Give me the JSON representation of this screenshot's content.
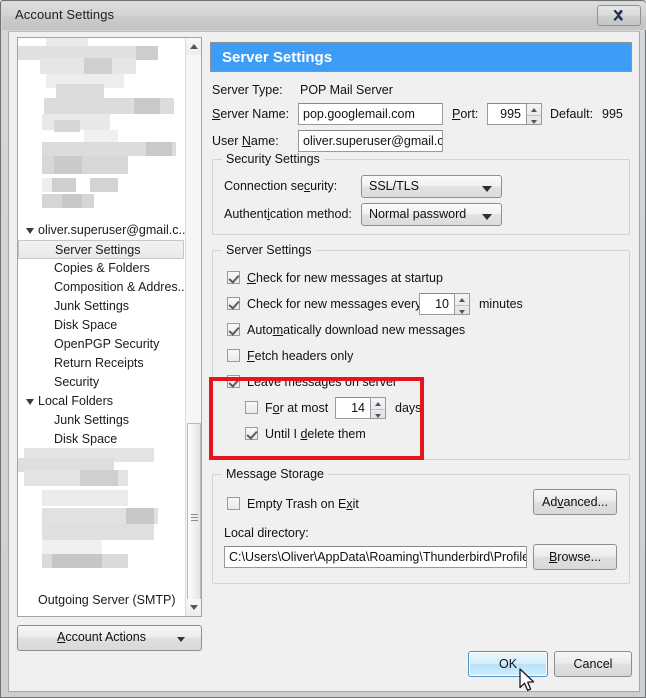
{
  "window": {
    "title": "Account Settings",
    "close_label": "Close"
  },
  "sidebar": {
    "tree": [
      {
        "label": "oliver.superuser@gmail.c...",
        "level": "root",
        "twisty": true,
        "selected": false,
        "redacted": false
      },
      {
        "label": "Server Settings",
        "level": "child",
        "twisty": false,
        "selected": true,
        "redacted": false
      },
      {
        "label": "Copies & Folders",
        "level": "child",
        "twisty": false,
        "selected": false,
        "redacted": false
      },
      {
        "label": "Composition & Addres...",
        "level": "child",
        "twisty": false,
        "selected": false,
        "redacted": false
      },
      {
        "label": "Junk Settings",
        "level": "child",
        "twisty": false,
        "selected": false,
        "redacted": false
      },
      {
        "label": "Disk Space",
        "level": "child",
        "twisty": false,
        "selected": false,
        "redacted": false
      },
      {
        "label": "OpenPGP Security",
        "level": "child",
        "twisty": false,
        "selected": false,
        "redacted": false
      },
      {
        "label": "Return Receipts",
        "level": "child",
        "twisty": false,
        "selected": false,
        "redacted": false
      },
      {
        "label": "Security",
        "level": "child",
        "twisty": false,
        "selected": false,
        "redacted": false
      },
      {
        "label": "Local Folders",
        "level": "root",
        "twisty": true,
        "selected": false,
        "redacted": false
      },
      {
        "label": "Junk Settings",
        "level": "child",
        "twisty": false,
        "selected": false,
        "redacted": false
      },
      {
        "label": "Disk Space",
        "level": "child",
        "twisty": false,
        "selected": false,
        "redacted": false
      },
      {
        "label": "Outgoing Server (SMTP)",
        "level": "leafroot",
        "twisty": false,
        "selected": false,
        "redacted": false
      }
    ],
    "account_actions": {
      "label": "Account Actions",
      "underline_index": 0
    }
  },
  "main": {
    "header": "Server Settings",
    "server_type": {
      "label": "Server Type:",
      "value": "POP Mail Server"
    },
    "server_name": {
      "label": "Server Name:",
      "value": "pop.googlemail.com"
    },
    "port": {
      "label": "Port:",
      "value": "995"
    },
    "default_port": {
      "label": "Default:",
      "value": "995"
    },
    "user_name": {
      "label": "User Name:",
      "value": "oliver.superuser@gmail.cc"
    },
    "security_settings": {
      "title": "Security Settings",
      "connection_security": {
        "label": "Connection security:",
        "value": "SSL/TLS"
      },
      "authentication_method": {
        "label": "Authentication method:",
        "value": "Normal password"
      }
    },
    "server_settings": {
      "title": "Server Settings",
      "check_at_startup": {
        "label": "Check for new messages at startup",
        "checked": true
      },
      "check_every": {
        "label": "Check for new messages every",
        "checked": true,
        "value": "10",
        "unit": "minutes"
      },
      "auto_download": {
        "label": "Automatically download new messages",
        "checked": true
      },
      "fetch_headers_only": {
        "label": "Fetch headers only",
        "checked": false
      },
      "leave_on_server": {
        "label": "Leave messages on server",
        "checked": true
      },
      "for_at_most": {
        "label": "For at most",
        "checked": false,
        "value": "14",
        "unit": "days"
      },
      "until_delete": {
        "label": "Until I delete them",
        "checked": true
      }
    },
    "message_storage": {
      "title": "Message Storage",
      "empty_trash": {
        "label": "Empty Trash on Exit",
        "checked": false
      },
      "advanced_button": "Advanced...",
      "local_directory": {
        "label": "Local directory:",
        "value": "C:\\Users\\Oliver\\AppData\\Roaming\\Thunderbird\\Profiles\\m"
      },
      "browse_button": "Browse..."
    }
  },
  "footer": {
    "ok_button": "OK",
    "cancel_button": "Cancel"
  },
  "colors": {
    "header_blue": "#3d9cf5",
    "highlight_red": "#e8131b",
    "dialog_bg": "#f0f0f0"
  }
}
